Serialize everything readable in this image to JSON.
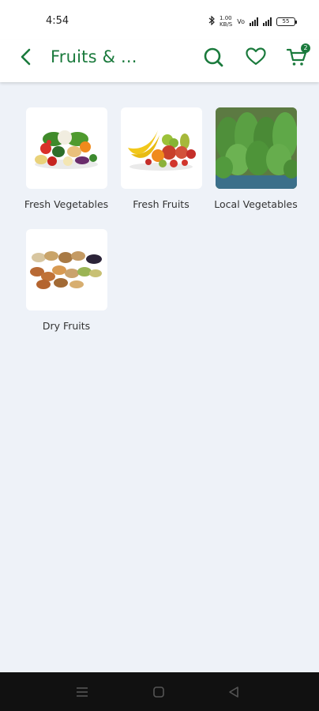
{
  "status_bar": {
    "time": "4:54",
    "net_speed_1": "1.00",
    "net_speed_2": "KB/S",
    "net_type": "Vo",
    "battery": "55"
  },
  "app_bar": {
    "title": "Fruits & ...",
    "cart_count": "2"
  },
  "categories": [
    {
      "label": "Fresh Vegetables",
      "image": "vegetables-image"
    },
    {
      "label": "Fresh Fruits",
      "image": "fruits-image"
    },
    {
      "label": "Local Vegetables",
      "image": "leafy-greens-image"
    },
    {
      "label": "Dry Fruits",
      "image": "dry-fruits-image"
    }
  ],
  "colors": {
    "brand_green": "#1a7a3c",
    "background": "#eef2f8",
    "nav_bar": "#111111"
  },
  "nav_bar": {
    "icons": [
      "menu-icon",
      "home-square-icon",
      "back-triangle-icon"
    ]
  }
}
